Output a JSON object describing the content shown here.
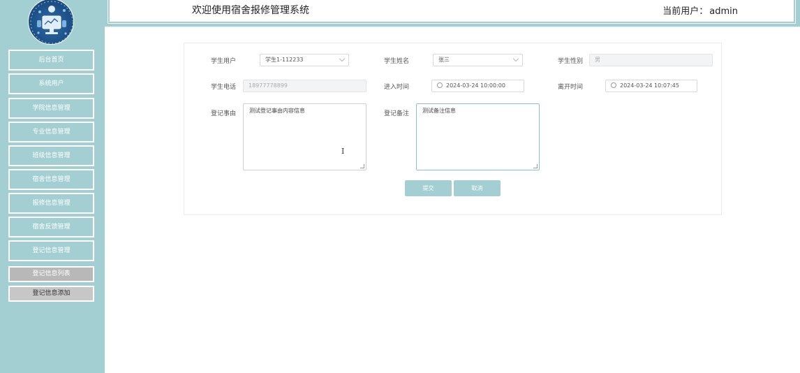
{
  "header": {
    "title": "欢迎使用宿舍报修管理系统",
    "user_prefix": "当前用户：",
    "user_name": "admin"
  },
  "sidebar": {
    "items": [
      {
        "label": "后台首页"
      },
      {
        "label": "系统用户"
      },
      {
        "label": "学院信息管理"
      },
      {
        "label": "专业信息管理"
      },
      {
        "label": "班级信息管理"
      },
      {
        "label": "宿舍信息管理"
      },
      {
        "label": "报修信息管理"
      },
      {
        "label": "宿舍反馈管理"
      },
      {
        "label": "登记信息管理"
      }
    ],
    "sub_items": [
      {
        "label": "登记信息列表"
      },
      {
        "label": "登记信息添加"
      }
    ]
  },
  "form": {
    "student_user_label": "学生用户",
    "student_user_value": "学生1-112233",
    "student_name_label": "学生姓名",
    "student_name_value": "张三",
    "student_gender_label": "学生性别",
    "student_gender_value": "男",
    "student_phone_label": "学生电话",
    "student_phone_value": "18977778899",
    "enter_time_label": "进入时间",
    "enter_time_value": "2024-03-24 10:00:00",
    "leave_time_label": "离开时间",
    "leave_time_value": "2024-03-24 10:07:45",
    "reason_label": "登记事由",
    "reason_value": "测试登记事由内容信息",
    "remark_label": "登记备注",
    "remark_value": "测试备注信息",
    "submit_label": "提交",
    "cancel_label": "取消"
  },
  "colors": {
    "accent": "#a3cfd2",
    "sub_item_1": "#b8b8b8",
    "sub_item_2": "#c7c7c7"
  },
  "icons": {
    "avatar": "robot-monitor-illustration",
    "dropdown": "chevron-down-icon",
    "time": "clock-icon",
    "cursor": "text-cursor-icon"
  }
}
